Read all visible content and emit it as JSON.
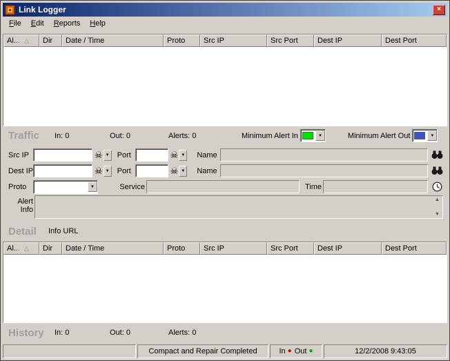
{
  "window": {
    "title": "Link Logger"
  },
  "menu": {
    "items": [
      "File",
      "Edit",
      "Reports",
      "Help"
    ]
  },
  "table_columns": [
    "Al...",
    "Dir",
    "Date / Time",
    "Proto",
    "Src IP",
    "Src Port",
    "Dest IP",
    "Dest Port"
  ],
  "traffic": {
    "section_label": "Traffic",
    "in_label": "In:",
    "in_value": "0",
    "out_label": "Out:",
    "out_value": "0",
    "alerts_label": "Alerts:",
    "alerts_value": "0",
    "min_alert_in_label": "Minimum Alert In",
    "min_alert_out_label": "Minimum Alert Out",
    "min_alert_in_color": "#00e400",
    "min_alert_out_color": "#3a56c8"
  },
  "detail": {
    "src_ip_label": "Src IP",
    "src_ip_value": "",
    "src_port_label": "Port",
    "src_port_value": "",
    "src_name_label": "Name",
    "src_name_value": "",
    "dest_ip_label": "Dest IP",
    "dest_ip_value": "",
    "dest_port_label": "Port",
    "dest_port_value": "",
    "dest_name_label": "Name",
    "dest_name_value": "",
    "proto_label": "Proto",
    "proto_value": "",
    "service_label": "Service",
    "service_value": "",
    "time_label": "Time",
    "time_value": "",
    "alert_label_line1": "Alert",
    "alert_label_line2": "Info",
    "alert_info_value": "",
    "section_label": "Detail",
    "info_url_label": "Info URL"
  },
  "history": {
    "section_label": "History",
    "in_label": "In:",
    "in_value": "0",
    "out_label": "Out:",
    "out_value": "0",
    "alerts_label": "Alerts:",
    "alerts_value": "0"
  },
  "status_bar": {
    "message": "Compact and Repair Completed",
    "in_label": "In",
    "out_label": "Out",
    "in_led_color": "#cc0000",
    "out_led_color": "#00a400",
    "timestamp": "12/2/2008 9:43:05"
  },
  "icons": {
    "close": "×",
    "sort_asc": "△",
    "dropdown": "▼",
    "skull": "☠",
    "scroll_up": "▲",
    "scroll_down": "▼",
    "led": "●"
  },
  "colors": {
    "titlebar_gradient_start": "#0a246a",
    "titlebar_gradient_end": "#a6caf0",
    "chrome": "#d4d0c8"
  }
}
